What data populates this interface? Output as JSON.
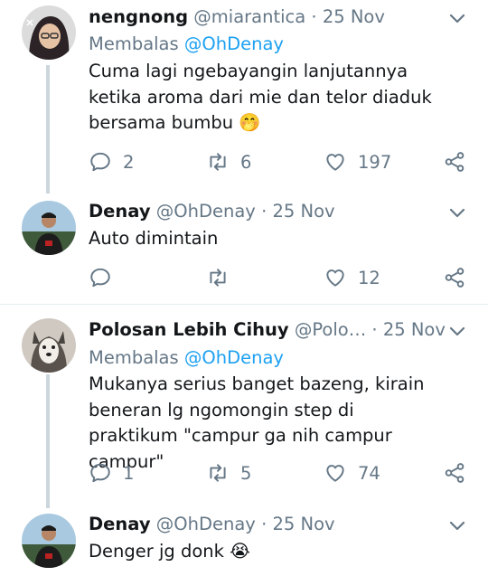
{
  "tweets": [
    {
      "name": "nengnong",
      "handle": "@miarantica",
      "dot": "·",
      "date": "25 Nov",
      "reply_label": "Membalas",
      "reply_mention": "@OhDenay",
      "text": "Cuma lagi ngebayangin lanjutannya ketika aroma dari mie dan telor diaduk bersama bumbu",
      "emoji": "🤭",
      "replies": "2",
      "retweets": "6",
      "likes": "197"
    },
    {
      "name": "Denay",
      "handle": "@OhDenay",
      "dot": "·",
      "date": "25 Nov",
      "text": "Auto dimintain",
      "replies": "",
      "retweets": "",
      "likes": "12"
    },
    {
      "name": "Polosan Lebih Cihuy",
      "handle": "@Polo…",
      "dot": "·",
      "date": "25 Nov",
      "reply_label": "Membalas",
      "reply_mention": "@OhDenay",
      "text": "Mukanya serius banget bazeng, kirain beneran lg ngomongin step di praktikum \"campur ga nih campur campur\"",
      "replies": "1",
      "retweets": "5",
      "likes": "74"
    },
    {
      "name": "Denay",
      "handle": "@OhDenay",
      "dot": "·",
      "date": "25 Nov",
      "text": "Denger jg donk",
      "emoji": "😭"
    }
  ],
  "colors": {
    "text": "#14171a",
    "muted": "#657786",
    "link": "#1da1f2",
    "thread_line": "#ccd6dd"
  }
}
